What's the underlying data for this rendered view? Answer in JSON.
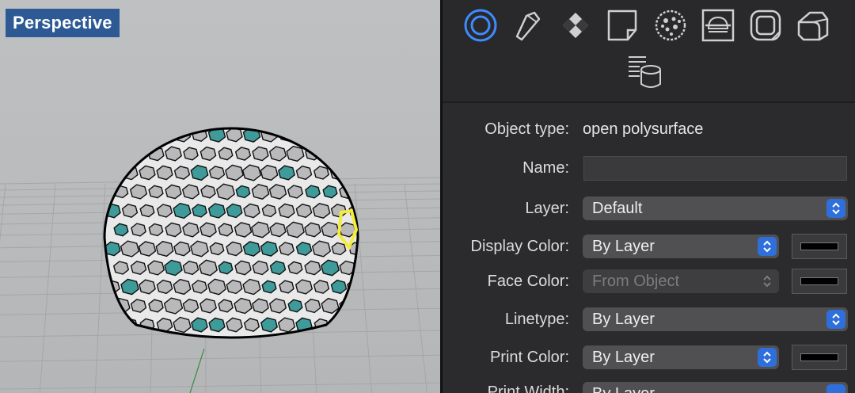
{
  "viewport": {
    "label": "Perspective"
  },
  "toolbar": {
    "icons": [
      "object-properties-icon",
      "material-icon",
      "texture-mapping-icon",
      "decal-icon",
      "displacement-icon",
      "section-style-icon",
      "edge-softening-icon",
      "fillet-edges-icon",
      "attribute-user-text-icon"
    ],
    "active_color": "#3d8bff"
  },
  "properties": {
    "object_type_label": "Object type:",
    "object_type_value": "open polysurface",
    "name_label": "Name:",
    "name_value": "",
    "layer_label": "Layer:",
    "layer_value": "Default",
    "display_color_label": "Display Color:",
    "display_color_value": "By Layer",
    "face_color_label": "Face Color:",
    "face_color_value": "From Object",
    "linetype_label": "Linetype:",
    "linetype_value": "By Layer",
    "print_color_label": "Print Color:",
    "print_color_value": "By Layer",
    "print_width_label": "Print Width:",
    "print_width_value": "By Layer",
    "swatch_color": "#000000"
  }
}
